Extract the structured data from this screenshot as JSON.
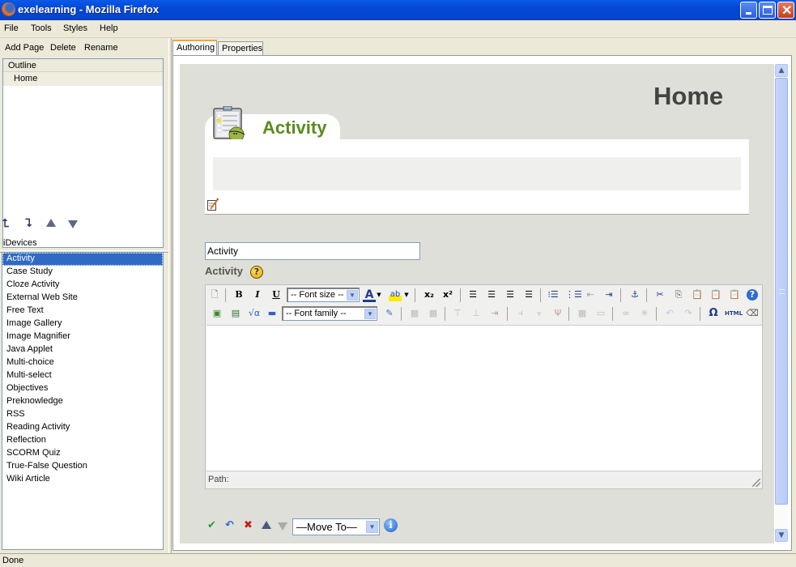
{
  "window": {
    "title": "exelearning - Mozilla Firefox",
    "controls": [
      "minimize",
      "maximize",
      "close"
    ]
  },
  "menubar": {
    "items": [
      {
        "label": "File",
        "access_key": "F"
      },
      {
        "label": "Tools",
        "access_key": "T"
      },
      {
        "label": "Styles",
        "access_key": "s"
      },
      {
        "label": "Help",
        "access_key": "H"
      }
    ]
  },
  "left_toolbar": {
    "add_page": "Add Page",
    "delete": "Delete",
    "rename": "Rename"
  },
  "outline": {
    "header": "Outline",
    "nodes": [
      "Home"
    ]
  },
  "outline_arrows": [
    "promote-icon",
    "demote-icon",
    "move-up-icon",
    "move-down-icon"
  ],
  "idevices": {
    "label": "iDevices",
    "selected": "Activity",
    "items": [
      "Activity",
      "Case Study",
      "Cloze Activity",
      "External Web Site",
      "Free Text",
      "Image Gallery",
      "Image Magnifier",
      "Java Applet",
      "Multi-choice",
      "Multi-select",
      "Objectives",
      "Preknowledge",
      "RSS",
      "Reading Activity",
      "Reflection",
      "SCORM Quiz",
      "True-False Question",
      "Wiki Article"
    ]
  },
  "tabs": [
    {
      "label": "Authoring",
      "active": true
    },
    {
      "label": "Properties",
      "active": false
    }
  ],
  "page": {
    "title": "Home",
    "idevice_title": "Activity"
  },
  "form": {
    "title_value": "Activity",
    "field_label": "Activity",
    "help_glyph": "?"
  },
  "editor": {
    "font_size_placeholder": "-- Font size --",
    "font_family_placeholder": "-- Font family --",
    "path_label": "Path:",
    "toolbar_row1": [
      "new-document",
      "bold",
      "italic",
      "underline",
      "font-size",
      "font-color",
      "highlight-color",
      "subscript",
      "superscript",
      "align-left",
      "align-center",
      "align-right",
      "align-justify",
      "bullet-list",
      "numbered-list",
      "outdent",
      "indent",
      "anchor",
      "cut",
      "copy",
      "paste",
      "paste-text",
      "paste-word",
      "help"
    ],
    "toolbar_row2": [
      "insert-image",
      "insert-media",
      "insert-math",
      "horizontal-rule",
      "font-family",
      "edit-styles",
      "table-row-props",
      "table-cell-props",
      "insert-row-before",
      "insert-row-after",
      "delete-row",
      "insert-col-before",
      "insert-col-after",
      "delete-col",
      "split-cells",
      "merge-cells",
      "link",
      "unlink",
      "undo",
      "redo",
      "special-char",
      "html-source",
      "remove-format"
    ]
  },
  "actions": {
    "move_to": "—Move To—",
    "buttons": [
      "done-icon",
      "undo-icon",
      "delete-icon",
      "move-up-icon",
      "move-down-icon"
    ],
    "info_glyph": "i"
  },
  "status": {
    "text": "Done"
  }
}
